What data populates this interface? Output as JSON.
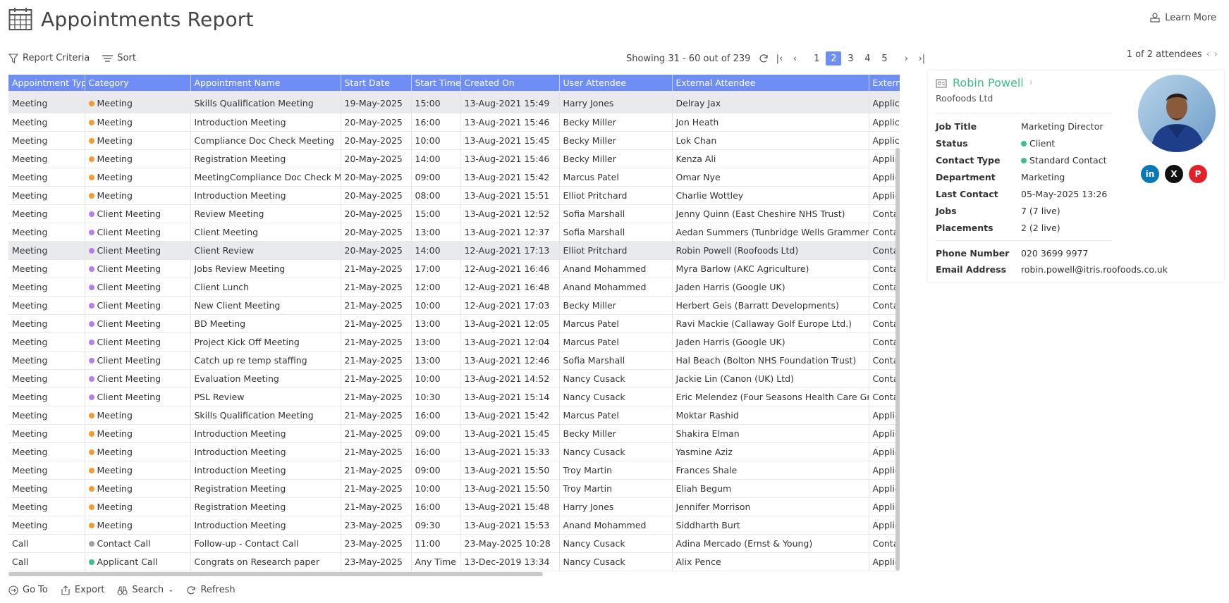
{
  "header": {
    "title": "Appointments Report",
    "learn_more": "Learn More"
  },
  "toolbar": {
    "report_criteria": "Report Criteria",
    "sort": "Sort"
  },
  "pager": {
    "showing": "Showing 31 - 60 out of 239",
    "pages": [
      "1",
      "2",
      "3",
      "4",
      "5"
    ],
    "active_page": "2"
  },
  "grid": {
    "columns": [
      "Appointment Type",
      "Category",
      "Appointment Name",
      "Start Date",
      "Start Time",
      "Created On",
      "User Attendee",
      "External Attendee",
      "Externa"
    ],
    "rows": [
      {
        "type": "Meeting",
        "cat": "Meeting",
        "color": "#f39a32",
        "name": "Skills Qualification Meeting",
        "sd": "19-May-2025",
        "st": "15:00",
        "co": "13-Aug-2021 15:49",
        "ua": "Harry Jones",
        "ea": "Delray Jax",
        "ex": "Applic",
        "hl": true
      },
      {
        "type": "Meeting",
        "cat": "Meeting",
        "color": "#f39a32",
        "name": "Introduction Meeting",
        "sd": "20-May-2025",
        "st": "16:00",
        "co": "13-Aug-2021 15:46",
        "ua": "Becky Miller",
        "ea": "Jon Heath",
        "ex": "Applic"
      },
      {
        "type": "Meeting",
        "cat": "Meeting",
        "color": "#f39a32",
        "name": "Compliance Doc Check Meeting",
        "sd": "20-May-2025",
        "st": "10:00",
        "co": "13-Aug-2021 15:45",
        "ua": "Becky Miller",
        "ea": "Lok Chan",
        "ex": "Applic"
      },
      {
        "type": "Meeting",
        "cat": "Meeting",
        "color": "#f39a32",
        "name": "Registration Meeting",
        "sd": "20-May-2025",
        "st": "14:00",
        "co": "13-Aug-2021 15:46",
        "ua": "Becky Miller",
        "ea": "Kenza Ali",
        "ex": "Applic"
      },
      {
        "type": "Meeting",
        "cat": "Meeting",
        "color": "#f39a32",
        "name": "MeetingCompliance Doc Check Mee",
        "sd": "20-May-2025",
        "st": "09:00",
        "co": "13-Aug-2021 15:42",
        "ua": "Marcus Patel",
        "ea": "Omar Nye",
        "ex": "Applic"
      },
      {
        "type": "Meeting",
        "cat": "Meeting",
        "color": "#f39a32",
        "name": "Introduction Meeting",
        "sd": "20-May-2025",
        "st": "08:00",
        "co": "13-Aug-2021 15:51",
        "ua": "Elliot Pritchard",
        "ea": "Charlie Wottley",
        "ex": "Applic"
      },
      {
        "type": "Meeting",
        "cat": "Client Meeting",
        "color": "#b57ee8",
        "name": "Review Meeting",
        "sd": "20-May-2025",
        "st": "15:00",
        "co": "13-Aug-2021 12:52",
        "ua": "Sofia Marshall",
        "ea": "Jenny Quinn (East Cheshire NHS Trust)",
        "ex": "Conta"
      },
      {
        "type": "Meeting",
        "cat": "Client Meeting",
        "color": "#b57ee8",
        "name": "Client Meeting",
        "sd": "20-May-2025",
        "st": "13:00",
        "co": "13-Aug-2021 12:37",
        "ua": "Sofia Marshall",
        "ea": "Aedan Summers (Tunbridge Wells Grammer Sch",
        "ex": "Conta"
      },
      {
        "type": "Meeting",
        "cat": "Client Meeting",
        "color": "#b57ee8",
        "name": "Client Review",
        "sd": "20-May-2025",
        "st": "14:00",
        "co": "12-Aug-2021 17:13",
        "ua": "Elliot Pritchard",
        "ea": "Robin Powell (Roofoods Ltd)",
        "ex": "Conta",
        "hl": true
      },
      {
        "type": "Meeting",
        "cat": "Client Meeting",
        "color": "#b57ee8",
        "name": "Jobs Review Meeting",
        "sd": "21-May-2025",
        "st": "17:00",
        "co": "12-Aug-2021 16:46",
        "ua": "Anand Mohammed",
        "ea": "Myra Barlow (AKC Agriculture)",
        "ex": "Conta"
      },
      {
        "type": "Meeting",
        "cat": "Client Meeting",
        "color": "#b57ee8",
        "name": "Client Lunch",
        "sd": "21-May-2025",
        "st": "12:00",
        "co": "12-Aug-2021 16:48",
        "ua": "Anand Mohammed",
        "ea": "Jaden Harris (Google UK)",
        "ex": "Conta"
      },
      {
        "type": "Meeting",
        "cat": "Client Meeting",
        "color": "#b57ee8",
        "name": "New Client Meeting",
        "sd": "21-May-2025",
        "st": "10:00",
        "co": "12-Aug-2021 17:03",
        "ua": "Becky Miller",
        "ea": "Herbert Geis (Barratt Developments)",
        "ex": "Conta"
      },
      {
        "type": "Meeting",
        "cat": "Client Meeting",
        "color": "#b57ee8",
        "name": "BD Meeting",
        "sd": "21-May-2025",
        "st": "13:00",
        "co": "13-Aug-2021 12:05",
        "ua": "Marcus Patel",
        "ea": "Ravi Mackie (Callaway Golf Europe Ltd.)",
        "ex": "Conta"
      },
      {
        "type": "Meeting",
        "cat": "Client Meeting",
        "color": "#b57ee8",
        "name": "Project Kick Off Meeting",
        "sd": "21-May-2025",
        "st": "13:00",
        "co": "13-Aug-2021 12:04",
        "ua": "Marcus Patel",
        "ea": "Jaden Harris (Google UK)",
        "ex": "Conta"
      },
      {
        "type": "Meeting",
        "cat": "Client Meeting",
        "color": "#b57ee8",
        "name": "Catch up re temp staffing",
        "sd": "21-May-2025",
        "st": "13:00",
        "co": "13-Aug-2021 12:46",
        "ua": "Sofia Marshall",
        "ea": "Hal Beach (Bolton NHS Foundation Trust)",
        "ex": "Conta"
      },
      {
        "type": "Meeting",
        "cat": "Client Meeting",
        "color": "#b57ee8",
        "name": "Evaluation Meeting",
        "sd": "21-May-2025",
        "st": "10:00",
        "co": "13-Aug-2021 14:52",
        "ua": "Nancy Cusack",
        "ea": "Jackie Lin (Canon (UK) Ltd)",
        "ex": "Conta"
      },
      {
        "type": "Meeting",
        "cat": "Client Meeting",
        "color": "#b57ee8",
        "name": "PSL Review",
        "sd": "21-May-2025",
        "st": "10:30",
        "co": "13-Aug-2021 15:14",
        "ua": "Nancy Cusack",
        "ea": "Eric Melendez (Four Seasons Health Care Group",
        "ex": "Conta"
      },
      {
        "type": "Meeting",
        "cat": "Meeting",
        "color": "#f39a32",
        "name": "Skills Qualification Meeting",
        "sd": "21-May-2025",
        "st": "16:00",
        "co": "13-Aug-2021 15:42",
        "ua": "Marcus Patel",
        "ea": "Moktar Rashid",
        "ex": "Applic"
      },
      {
        "type": "Meeting",
        "cat": "Meeting",
        "color": "#f39a32",
        "name": "Introduction Meeting",
        "sd": "21-May-2025",
        "st": "09:00",
        "co": "13-Aug-2021 15:45",
        "ua": "Becky Miller",
        "ea": "Shakira Elman",
        "ex": "Applic"
      },
      {
        "type": "Meeting",
        "cat": "Meeting",
        "color": "#f39a32",
        "name": "Introduction Meeting",
        "sd": "21-May-2025",
        "st": "16:00",
        "co": "13-Aug-2021 15:33",
        "ua": "Nancy Cusack",
        "ea": "Yasmine Aziz",
        "ex": "Applic"
      },
      {
        "type": "Meeting",
        "cat": "Meeting",
        "color": "#f39a32",
        "name": "Introduction Meeting",
        "sd": "21-May-2025",
        "st": "09:00",
        "co": "13-Aug-2021 15:50",
        "ua": "Troy Martin",
        "ea": "Frances Shale",
        "ex": "Applic"
      },
      {
        "type": "Meeting",
        "cat": "Meeting",
        "color": "#f39a32",
        "name": "Registration Meeting",
        "sd": "21-May-2025",
        "st": "10:00",
        "co": "13-Aug-2021 15:50",
        "ua": "Troy Martin",
        "ea": "Eliah Begum",
        "ex": "Applic"
      },
      {
        "type": "Meeting",
        "cat": "Meeting",
        "color": "#f39a32",
        "name": "Registration Meeting",
        "sd": "21-May-2025",
        "st": "16:00",
        "co": "13-Aug-2021 15:48",
        "ua": "Harry Jones",
        "ea": "Jennifer Morrison",
        "ex": "Applic"
      },
      {
        "type": "Meeting",
        "cat": "Meeting",
        "color": "#f39a32",
        "name": "Introduction Meeting",
        "sd": "23-May-2025",
        "st": "09:30",
        "co": "13-Aug-2021 15:53",
        "ua": "Anand Mohammed",
        "ea": "Siddharth Burt",
        "ex": "Applic"
      },
      {
        "type": "Call",
        "cat": "Contact Call",
        "color": "#9aa3ad",
        "name": "Follow-up - Contact Call",
        "sd": "23-May-2025",
        "st": "11:00",
        "co": "23-May-2025 10:28",
        "ua": "Nancy Cusack",
        "ea": "Adina Mercado (Ernst & Young)",
        "ex": "Conta"
      },
      {
        "type": "Call",
        "cat": "Applicant Call",
        "color": "#3dbf8a",
        "name": "Congrats on Research paper",
        "sd": "23-May-2025",
        "st": "Any Time",
        "co": "13-Dec-2019 13:34",
        "ua": "Nancy Cusack",
        "ea": "Alix Pence",
        "ex": "Applic"
      }
    ]
  },
  "bottombar": {
    "goto": "Go To",
    "export": "Export",
    "search": "Search",
    "refresh": "Refresh"
  },
  "attendees_nav": "1 of 2 attendees",
  "card": {
    "name": "Robin Powell",
    "company": "Roofoods Ltd",
    "status_color": "#3dbf8a",
    "fields": [
      {
        "label": "Job Title",
        "value": "Marketing Director"
      },
      {
        "label": "Status",
        "value": "Client"
      },
      {
        "label": "Contact Type",
        "value": "Standard Contact"
      },
      {
        "label": "Department",
        "value": "Marketing"
      },
      {
        "label": "Last Contact",
        "value": "05-May-2025 13:26"
      },
      {
        "label": "Jobs",
        "value": "7 (7 live)"
      },
      {
        "label": "Placements",
        "value": "2 (2 live)"
      }
    ],
    "phone_label": "Phone Number",
    "phone": "020 3699 9977",
    "email_label": "Email Address",
    "email": "robin.powell@itris.roofoods.co.uk",
    "social": [
      "linkedin-icon",
      "x-icon",
      "pinterest-icon"
    ]
  }
}
